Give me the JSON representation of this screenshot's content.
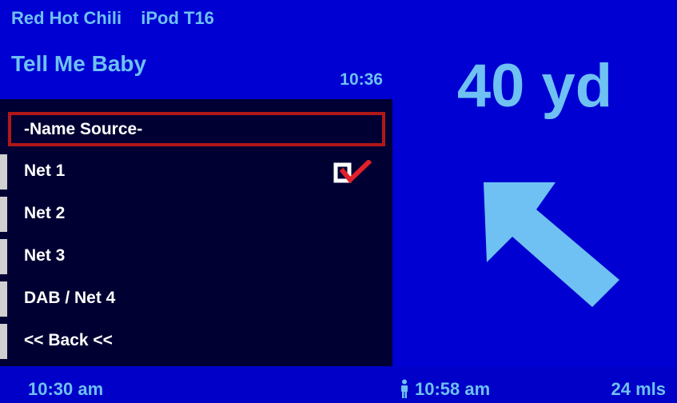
{
  "header": {
    "artist": "Red Hot Chili",
    "source": "iPod T16",
    "track_title": "Tell Me Baby",
    "track_time": "10:36"
  },
  "menu": {
    "title": "-Name Source-",
    "items": [
      {
        "label": "Net 1",
        "checked": true
      },
      {
        "label": "Net 2",
        "checked": false
      },
      {
        "label": "Net 3",
        "checked": false
      },
      {
        "label": "DAB / Net 4",
        "checked": false
      },
      {
        "label": "<< Back <<",
        "checked": false
      }
    ]
  },
  "navigation": {
    "distance": "40 yd",
    "arrow": "arrow-up-left-icon"
  },
  "status_bar": {
    "clock": "10:30 am",
    "eta": "10:58 am",
    "distance_remaining": "24 mls"
  },
  "colors": {
    "background": "#0000C8",
    "menu_background": "#000033",
    "text_light_blue": "#6EC1F2",
    "selection_border": "#B01818",
    "check_red": "#E0202A"
  }
}
